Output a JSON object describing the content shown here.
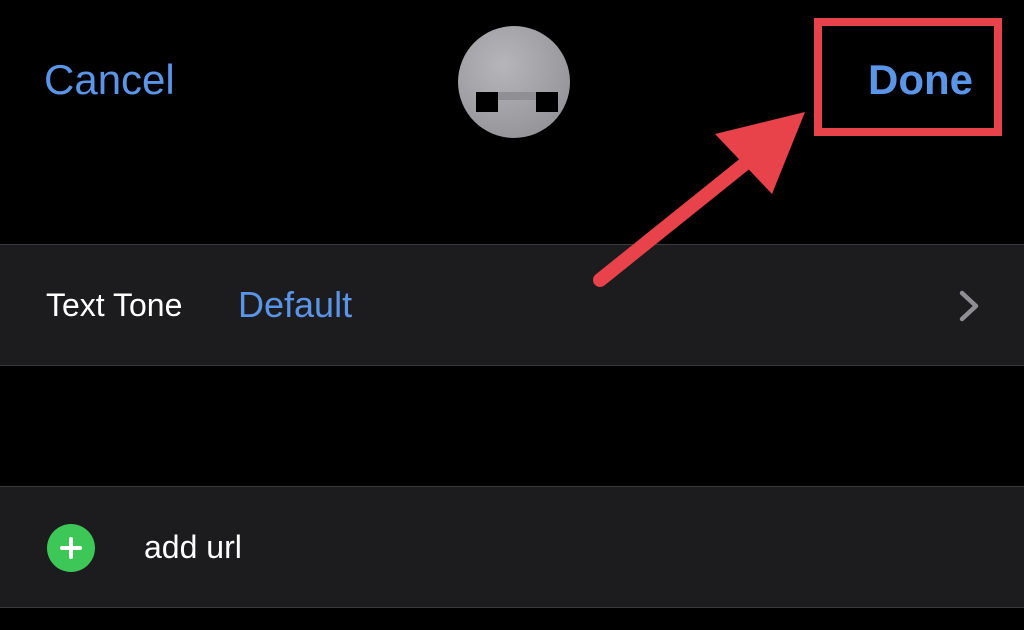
{
  "nav": {
    "cancel_label": "Cancel",
    "done_label": "Done"
  },
  "contact": {
    "avatar": "contact-avatar"
  },
  "text_tone": {
    "label": "Text Tone",
    "value": "Default",
    "chevron_icon": "chevron-right-icon"
  },
  "url": {
    "add_icon": "plus-circle-icon",
    "label": "add url"
  },
  "annotation": {
    "highlight_color": "#e8424b",
    "target": "Done"
  },
  "colors": {
    "background": "#000000",
    "row_background": "#1c1c1e",
    "accent": "#5b95e8",
    "add_green": "#3dc757"
  }
}
